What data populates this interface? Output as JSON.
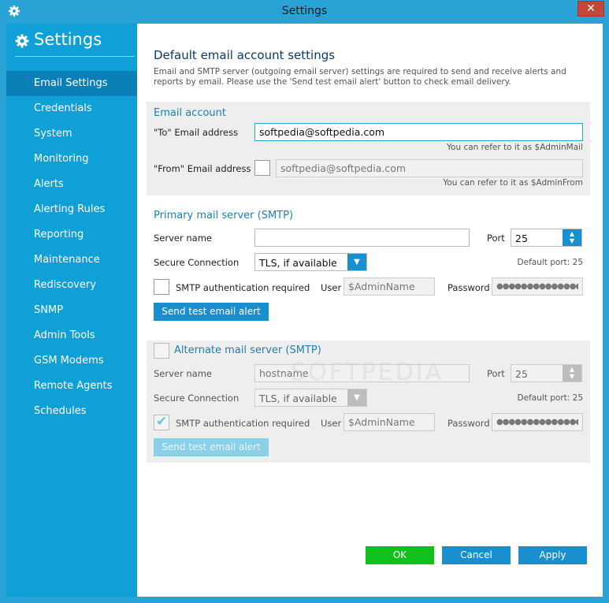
{
  "window": {
    "title": "Settings",
    "close_glyph": "✕"
  },
  "sidebar": {
    "heading": "Settings",
    "items": [
      {
        "label": "Email Settings",
        "active": true
      },
      {
        "label": "Credentials"
      },
      {
        "label": "System"
      },
      {
        "label": "Monitoring"
      },
      {
        "label": "Alerts"
      },
      {
        "label": "Alerting Rules"
      },
      {
        "label": "Reporting"
      },
      {
        "label": "Maintenance"
      },
      {
        "label": "Rediscovery"
      },
      {
        "label": "SNMP"
      },
      {
        "label": "Admin Tools"
      },
      {
        "label": "GSM Modems"
      },
      {
        "label": "Remote Agents"
      },
      {
        "label": "Schedules"
      }
    ]
  },
  "main": {
    "title": "Default email account settings",
    "description": "Email and SMTP server (outgoing email server) settings are required to send and receive alerts and reports by email. Please use the 'Send test email alert' button to check email delivery.",
    "email_account": {
      "title": "Email account",
      "to_label": "\"To\" Email address",
      "to_value": "softpedia@softpedia.com",
      "to_hint": "You can refer to it as $AdminMail",
      "from_label": "\"From\" Email address",
      "from_value": "softpedia@softpedia.com",
      "from_hint": "You can refer to it as $AdminFrom"
    },
    "primary": {
      "title": "Primary mail server (SMTP)",
      "server_label": "Server name",
      "server_value": "",
      "port_label": "Port",
      "port_value": "25",
      "secure_label": "Secure Connection",
      "secure_value": "TLS, if available",
      "default_port": "Default port: 25",
      "auth_label": "SMTP authentication required",
      "user_label": "User",
      "user_value": "$AdminName",
      "password_label": "Password",
      "password_value": "●●●●●●●●●●●●●●",
      "test_button": "Send test email alert"
    },
    "alternate": {
      "title": "Alternate mail server (SMTP)",
      "server_label": "Server name",
      "server_value": "hostname",
      "port_label": "Port",
      "port_value": "25",
      "secure_label": "Secure Connection",
      "secure_value": "TLS, if available",
      "default_port": "Default port: 25",
      "auth_label": "SMTP authentication required",
      "user_label": "User",
      "user_value": "$AdminName",
      "password_label": "Password",
      "password_value": "●●●●●●●●●●●●●●",
      "test_button": "Send test email alert"
    },
    "watermark": "SOFTPEDIA",
    "buttons": {
      "ok": "OK",
      "cancel": "Cancel",
      "apply": "Apply"
    }
  },
  "colors": {
    "accent": "#29a3d6",
    "sidebar": "#0ea0d6",
    "active_item": "#0a7fb8",
    "button": "#1a8fd0",
    "ok": "#11c01a",
    "close": "#c7443b"
  }
}
